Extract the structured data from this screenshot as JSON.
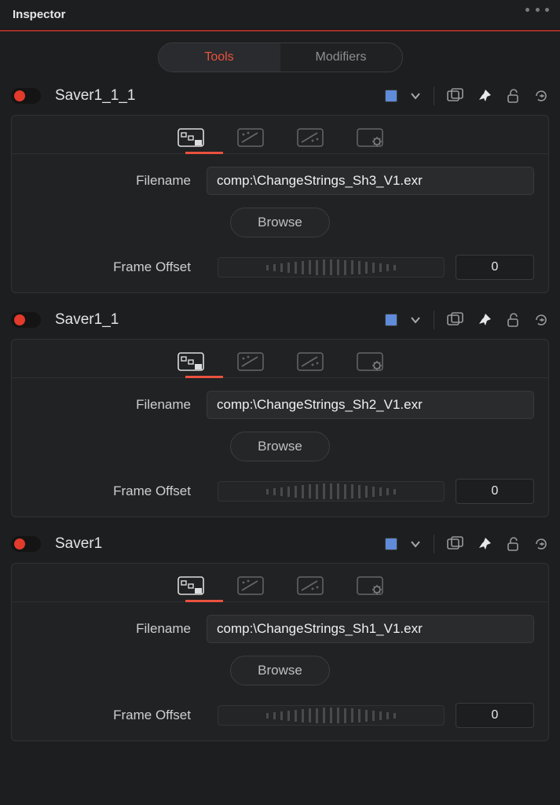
{
  "panel_title": "Inspector",
  "tabs": {
    "tools": "Tools",
    "modifiers": "Modifiers"
  },
  "labels": {
    "filename": "Filename",
    "frame_offset": "Frame Offset",
    "browse": "Browse"
  },
  "nodes": [
    {
      "name": "Saver1_1_1",
      "filename": "comp:\\ChangeStrings_Sh3_V1.exr",
      "frame_offset": "0"
    },
    {
      "name": "Saver1_1",
      "filename": "comp:\\ChangeStrings_Sh2_V1.exr",
      "frame_offset": "0"
    },
    {
      "name": "Saver1",
      "filename": "comp:\\ChangeStrings_Sh1_V1.exr",
      "frame_offset": "0"
    }
  ]
}
